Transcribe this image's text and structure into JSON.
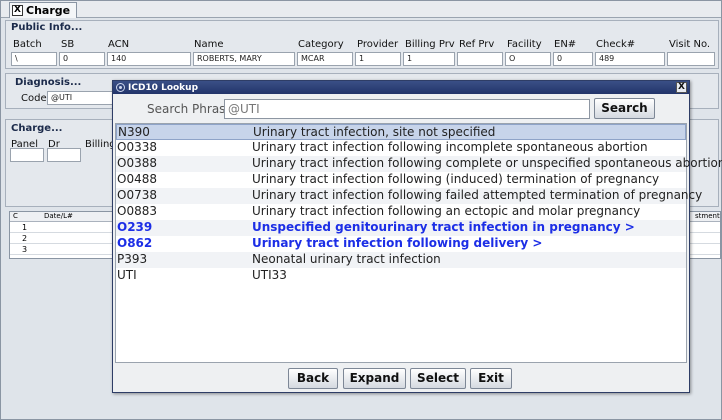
{
  "tab": {
    "label": "Charge",
    "close_glyph": "X"
  },
  "public_info": {
    "title": "Public Info...",
    "columns": [
      "Batch",
      "SB",
      "ACN",
      "Name",
      "Category",
      "Provider",
      "Billing Prv",
      "Ref Prv",
      "Facility",
      "EN#",
      "Check#",
      "Visit No."
    ],
    "values": [
      "\\",
      "0",
      "140",
      "ROBERTS, MARY",
      "MCAR",
      "1",
      "1",
      "",
      "O",
      "0",
      "489",
      ""
    ]
  },
  "diagnosis": {
    "title": "Diagnosis...",
    "code_label": "Code",
    "code_value": "@UTI"
  },
  "charge": {
    "title": "Charge...",
    "labels": [
      "Panel",
      "Dr",
      "Billing"
    ]
  },
  "grid": {
    "headers": [
      "C",
      "Date/L#",
      "stment"
    ],
    "rows": [
      "1",
      "2",
      "3"
    ]
  },
  "dialog": {
    "title": "ICD10 Lookup",
    "close_glyph": "X",
    "search_label": "Search Phrase:",
    "search_value": "@UTI",
    "search_button": "Search",
    "items": [
      {
        "code": "N390",
        "desc": "Urinary tract infection, site not specified",
        "selected": true,
        "blue": false
      },
      {
        "code": "O0338",
        "desc": "Urinary tract infection following incomplete spontaneous abortion",
        "selected": false,
        "blue": false
      },
      {
        "code": "O0388",
        "desc": "Urinary tract infection following complete or unspecified spontaneous abortion",
        "selected": false,
        "blue": false
      },
      {
        "code": "O0488",
        "desc": "Urinary tract infection following (induced) termination of pregnancy",
        "selected": false,
        "blue": false
      },
      {
        "code": "O0738",
        "desc": "Urinary tract infection following failed attempted termination of pregnancy",
        "selected": false,
        "blue": false
      },
      {
        "code": "O0883",
        "desc": "Urinary tract infection following an ectopic and molar pregnancy",
        "selected": false,
        "blue": false
      },
      {
        "code": "O239",
        "desc": "Unspecified genitourinary tract infection in pregnancy  >",
        "selected": false,
        "blue": true
      },
      {
        "code": "O862",
        "desc": "Urinary tract infection following delivery  >",
        "selected": false,
        "blue": true
      },
      {
        "code": "P393",
        "desc": "Neonatal urinary tract infection",
        "selected": false,
        "blue": false
      },
      {
        "code": "UTI",
        "desc": "UTI33",
        "selected": false,
        "blue": false
      }
    ],
    "buttons": {
      "back": "Back",
      "expand": "Expand",
      "select": "Select",
      "exit": "Exit"
    }
  }
}
